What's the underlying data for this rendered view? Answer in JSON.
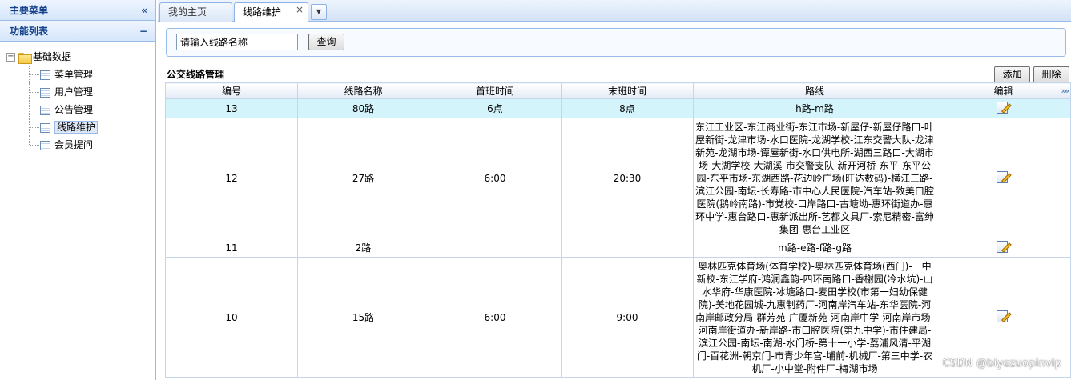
{
  "sidebar": {
    "header": "主要菜单",
    "collapse_glyph": "«",
    "section_title": "功能列表",
    "section_toggle": "−",
    "tree": {
      "root_label": "基础数据",
      "root_expander": "−",
      "items": [
        {
          "label": "菜单管理"
        },
        {
          "label": "用户管理"
        },
        {
          "label": "公告管理"
        },
        {
          "label": "线路维护"
        },
        {
          "label": "会员提问"
        }
      ]
    }
  },
  "tabs": {
    "items": [
      {
        "label": "我的主页"
      },
      {
        "label": "线路维护"
      }
    ],
    "close_glyph": "×",
    "menu_glyph": "▼"
  },
  "search": {
    "input_value": "请输入线路名称",
    "button_label": "查询"
  },
  "grid": {
    "title": "公交线路管理",
    "add_label": "添加",
    "delete_label": "删除",
    "columns": [
      "编号",
      "线路名称",
      "首班时间",
      "末班时间",
      "路线",
      "编辑"
    ],
    "more_glyph": "»»",
    "rows": [
      {
        "id": "13",
        "name": "80路",
        "first": "6点",
        "last": "8点",
        "route": "h路-m路"
      },
      {
        "id": "12",
        "name": "27路",
        "first": "6:00",
        "last": "20:30",
        "route": "东江工业区-东江商业街-东江市场-新屋仔-新屋仔路口-叶屋新街-龙津市场-水口医院-龙湖学校-江东交警大队-龙津新苑-龙湖市场-谭屋新街-水口供电所-湖西三路口-大湖市场-大湖学校-大湖溪-市交警支队-新开河桥-东平-东平公园-东平市场-东湖西路-花边岭广场(旺达数码)-横江三路-滨江公园-南坛-长寿路-市中心人民医院-汽车站-致美口腔医院(鹅岭南路)-市党校-口岸路口-古塘坳-惠环街道办-惠环中学-惠台路口-惠新派出所-艺都文具厂-索尼精密-富绅集团-惠台工业区"
      },
      {
        "id": "11",
        "name": "2路",
        "first": "",
        "last": "",
        "route": "m路-e路-f路-g路"
      },
      {
        "id": "10",
        "name": "15路",
        "first": "6:00",
        "last": "9:00",
        "route": "奥林匹克体育场(体育学校)-奥林匹克体育场(西门)-一中新校-东江学府-鸿润鑫韵-四环南路口-香榭园(冷水坑)-山水华府-华康医院-冰塘路口-麦田学校(市第一妇幼保健院)-美地花园城-九惠制药厂-河南岸汽车站-东华医院-河南岸邮政分局-群芳苑-广厦新苑-河南岸中学-河南岸市场-河南岸街道办-新岸路-市口腔医院(第九中学)-市住建局-滨江公园-南坛-南湖-水门桥-第十一小学-荔浦风清-平湖门-百花洲-朝京门-市青少年宫-埔前-机械厂-第三中学-农机厂-小中堂-附件厂-梅湖市场"
      }
    ]
  },
  "watermark": "CSDN @biyezuopinvip"
}
